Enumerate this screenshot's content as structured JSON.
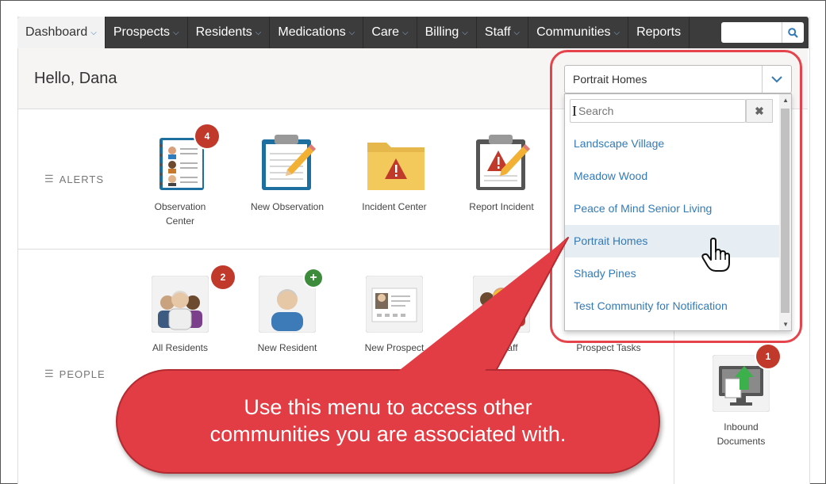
{
  "nav": {
    "items": [
      {
        "label": "Dashboard",
        "chevron": true
      },
      {
        "label": "Prospects",
        "chevron": true
      },
      {
        "label": "Residents",
        "chevron": true
      },
      {
        "label": "Medications",
        "chevron": true
      },
      {
        "label": "Care",
        "chevron": true
      },
      {
        "label": "Billing",
        "chevron": true
      },
      {
        "label": "Staff",
        "chevron": true
      },
      {
        "label": "Communities",
        "chevron": true
      },
      {
        "label": "Reports",
        "chevron": false
      }
    ],
    "search_placeholder": "",
    "search_icon": "search-icon"
  },
  "header": {
    "greeting": "Hello, Dana"
  },
  "community_select": {
    "value": "Portrait Homes",
    "search_placeholder": "Search",
    "clear_label": "✖",
    "options": [
      "Landscape Village",
      "Meadow Wood",
      "Peace of Mind Senior Living",
      "Portrait Homes",
      "Shady Pines",
      "Test Community for Notification"
    ],
    "selected_index": 3
  },
  "sections": {
    "alerts": {
      "label": "ALERTS",
      "tiles": [
        {
          "label": "Observation Center",
          "badge": "4",
          "icon": "observation-notebook-icon"
        },
        {
          "label": "New Observation",
          "icon": "clipboard-pencil-icon"
        },
        {
          "label": "Incident Center",
          "icon": "warning-folder-icon"
        },
        {
          "label": "Report Incident",
          "icon": "warning-clipboard-icon"
        }
      ]
    },
    "people": {
      "label": "PEOPLE",
      "tiles": [
        {
          "label": "All Residents",
          "badge": "2",
          "icon": "residents-group-icon"
        },
        {
          "label": "New Resident",
          "icon": "add-person-icon"
        },
        {
          "label": "New Prospect",
          "icon": "prospect-card-icon"
        },
        {
          "label": "All Staff",
          "icon": "staff-group-icon"
        },
        {
          "label": "Prospect Tasks",
          "icon": "tasks-icon"
        }
      ]
    },
    "side": {
      "label": "Inbound Documents",
      "badge": "1",
      "icon": "inbound-documents-icon"
    }
  },
  "callout": {
    "line1": "Use this menu to access other",
    "line2": "communities you are associated with."
  },
  "colors": {
    "accent": "#337ab7",
    "nav_bg": "#3c3c3c",
    "callout": "#e23d44",
    "badge": "#c0392b"
  }
}
